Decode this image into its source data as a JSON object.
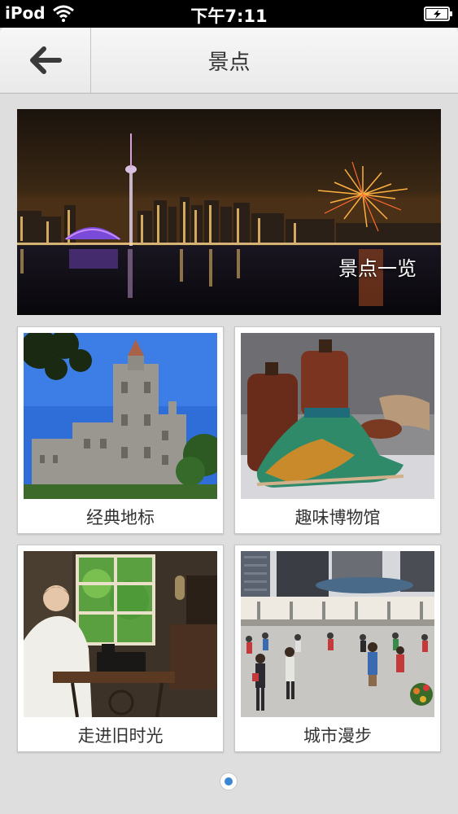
{
  "status_bar": {
    "carrier": "iPod",
    "time": "下午7:11",
    "wifi_icon": "wifi-icon",
    "battery_icon": "battery-charging-icon"
  },
  "nav": {
    "back_icon": "arrow-left-icon",
    "title": "景点"
  },
  "banner": {
    "label": "景点一览"
  },
  "tiles": [
    {
      "label": "经典地标"
    },
    {
      "label": "趣味博物馆"
    },
    {
      "label": "走进旧时光"
    },
    {
      "label": "城市漫步"
    }
  ],
  "pager": {
    "accent": "#3b86d2"
  }
}
